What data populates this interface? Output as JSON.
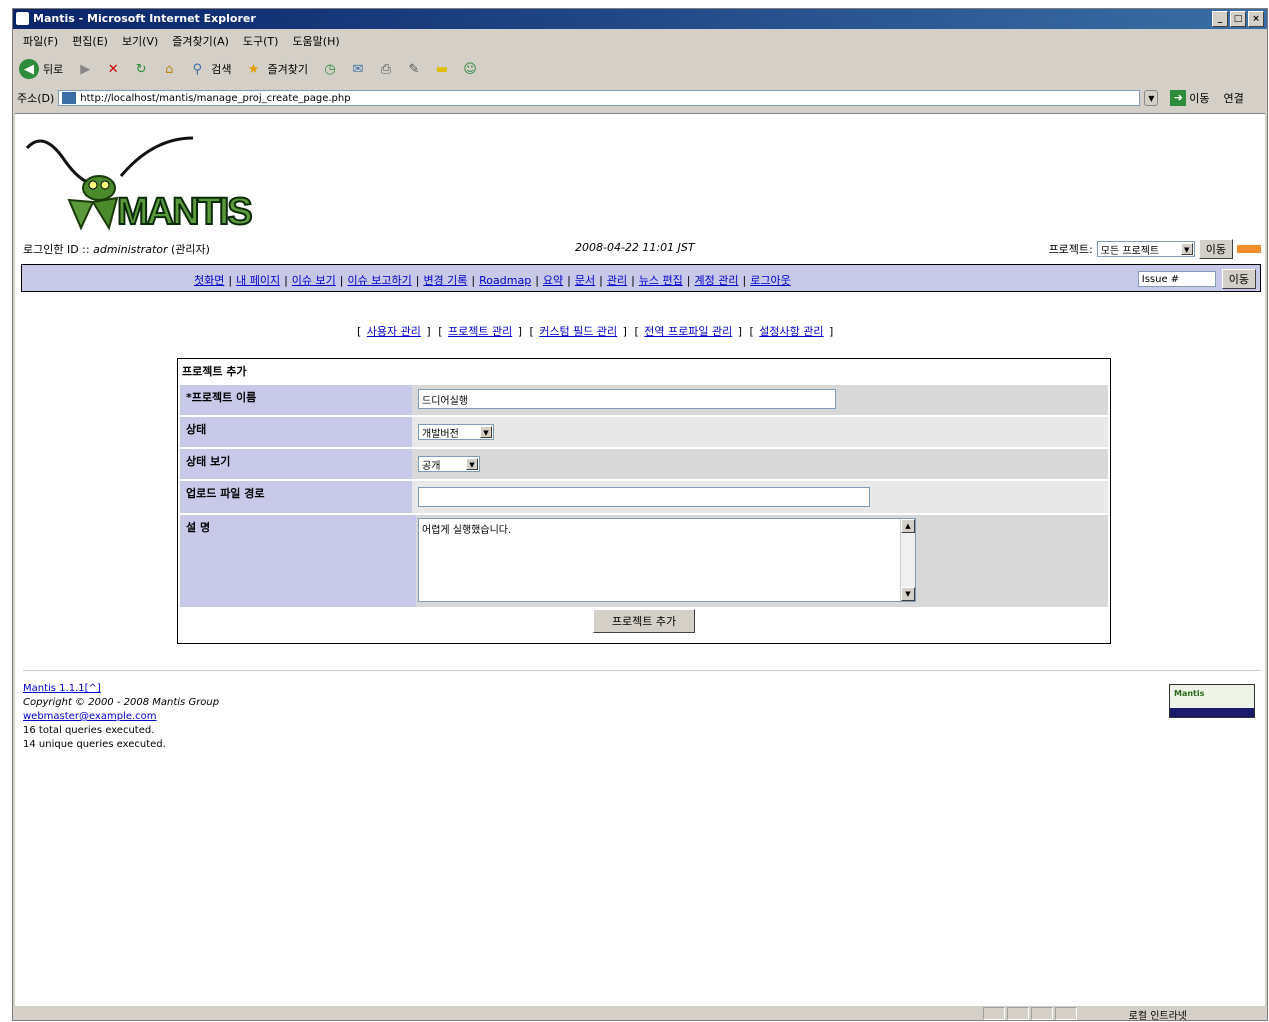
{
  "window": {
    "title": "Mantis - Microsoft Internet Explorer",
    "controls": [
      "_",
      "□",
      "×"
    ]
  },
  "menubar": [
    "파일(F)",
    "편집(E)",
    "보기(V)",
    "즐겨찾기(A)",
    "도구(T)",
    "도움말(H)"
  ],
  "toolbar": {
    "back": "뒤로",
    "search": "검색",
    "favorites": "즐겨찾기"
  },
  "address": {
    "label": "주소(D)",
    "url": "http://localhost/mantis/manage_proj_create_page.php",
    "go": "이동",
    "links": "연결"
  },
  "header": {
    "login_label": "로그인한 ID :: ",
    "username": "administrator",
    "role": "(관리자)",
    "datetime": "2008-04-22 11:01 JST",
    "project_label": "프로젝트:",
    "project_selected": "모든 프로젝트",
    "switch_button": "이동"
  },
  "main_menu": [
    "첫화면",
    "내 페이지",
    "이슈 보기",
    "이슈 보고하기",
    "변경 기록",
    "Roadmap",
    "요약",
    "문서",
    "관리",
    "뉴스 편집",
    "계정 관리",
    "로그아웃"
  ],
  "jump": {
    "placeholder": "Issue #",
    "button": "이동"
  },
  "admin_menu": [
    "사용자 관리",
    "프로젝트 관리",
    "커스텀 필드 관리",
    "전역 프로파일 관리",
    "설정사항 관리"
  ],
  "form": {
    "title": "프로젝트 추가",
    "name_label": "*프로젝트 이름",
    "name_value": "드디어실행",
    "status_label": "상태",
    "status_value": "개발버전",
    "view_label": "상태 보기",
    "view_value": "공개",
    "upload_label": "업로드 파일 경로",
    "upload_value": "",
    "desc_label": "설 명",
    "desc_value": "어렵게 실행했습니다.",
    "submit": "프로젝트 추가"
  },
  "footer": {
    "version": "Mantis 1.1.1[^]",
    "copyright": "Copyright © 2000 - 2008 Mantis Group",
    "email": "webmaster@example.com",
    "queries_total": "16 total queries executed.",
    "queries_unique": "14 unique queries executed.",
    "badge": "Mantis"
  },
  "status": {
    "zone": "로컬 인트라넷"
  }
}
